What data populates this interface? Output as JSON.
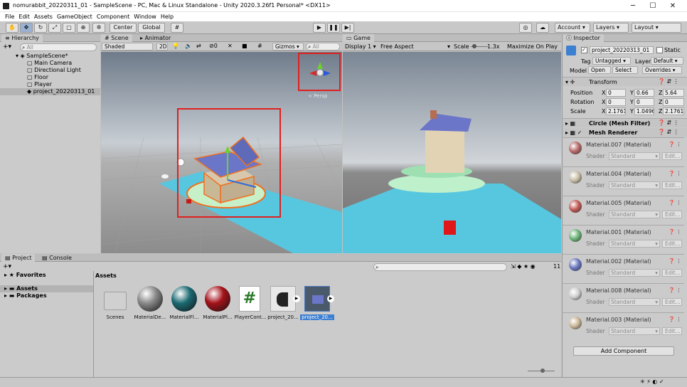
{
  "window": {
    "title": "nomurabbit_20220311_01 - SampleScene - PC, Mac & Linux Standalone - Unity 2020.3.26f1 Personal* <DX11>",
    "minimize": "─",
    "maximize": "☐",
    "close": "✕"
  },
  "menu": [
    "File",
    "Edit",
    "Assets",
    "GameObject",
    "Component",
    "Window",
    "Help"
  ],
  "toolbar": {
    "pivot": "Center",
    "space": "Global",
    "account": "Account",
    "layers": "Layers",
    "layout": "Layout"
  },
  "hierarchy": {
    "tab": "Hierarchy",
    "search_placeholder": "All",
    "scene": "SampleScene*",
    "items": [
      "Main Camera",
      "Directional Light",
      "Floor",
      "Player",
      "project_20220313_01"
    ]
  },
  "scene": {
    "tab": "Scene",
    "tab2": "Animator",
    "shading": "Shaded",
    "mode": "2D",
    "gizmos": "Gizmos",
    "search_placeholder": "All",
    "persp": "< Persp",
    "layer_count": "0"
  },
  "game": {
    "tab": "Game",
    "display": "Display 1",
    "aspect": "Free Aspect",
    "scale_label": "Scale",
    "scale": "1.3x",
    "maximize": "Maximize On Play"
  },
  "inspector": {
    "tab": "Inspector",
    "object_name": "project_20220313_01",
    "static": "Static",
    "tag_label": "Tag",
    "tag": "Untagged",
    "layer_label": "Layer",
    "layer": "Default",
    "model_label": "Model",
    "open": "Open",
    "select": "Select",
    "overrides": "Overrides",
    "transform": "Transform",
    "position": {
      "label": "Position",
      "x": "0",
      "y": "0.66",
      "z": "5.64"
    },
    "rotation": {
      "label": "Rotation",
      "x": "0",
      "y": "0",
      "z": "0"
    },
    "scale": {
      "label": "Scale",
      "x": "2.17613",
      "y": "1.04962",
      "z": "2.17613"
    },
    "mesh_filter": "Circle (Mesh Filter)",
    "mesh_renderer": "Mesh Renderer",
    "shader_label": "Shader",
    "shader_value": "Standard",
    "edit": "Edit...",
    "materials": [
      {
        "name": "Material.007 (Material)",
        "color": "#b86a6a"
      },
      {
        "name": "Material.004 (Material)",
        "color": "#c9c0a8"
      },
      {
        "name": "Material.005 (Material)",
        "color": "#c25c56"
      },
      {
        "name": "Material.001 (Material)",
        "color": "#6eb57a"
      },
      {
        "name": "Material.002 (Material)",
        "color": "#6a78c0"
      },
      {
        "name": "Material.008 (Material)",
        "color": "#d0d0d0"
      },
      {
        "name": "Material.003 (Material)",
        "color": "#cbb79a"
      }
    ],
    "add_component": "Add Component"
  },
  "project": {
    "tab": "Project",
    "tab2": "Console",
    "count": "11",
    "favorites": "Favorites",
    "assets_folder": "Assets",
    "packages": "Packages",
    "header": "Assets",
    "assets": [
      {
        "name": "Scenes",
        "icon": "folder-icon"
      },
      {
        "name": "MaterialDe...",
        "icon": "sphere-gray-icon"
      },
      {
        "name": "MaterialFl...",
        "icon": "sphere-teal-icon"
      },
      {
        "name": "MaterialPl...",
        "icon": "sphere-red-icon"
      },
      {
        "name": "PlayerCont...",
        "icon": "csharp-script-icon"
      },
      {
        "name": "project_20...",
        "icon": "model-icon"
      },
      {
        "name": "project_20...",
        "icon": "prefab-icon"
      }
    ]
  }
}
